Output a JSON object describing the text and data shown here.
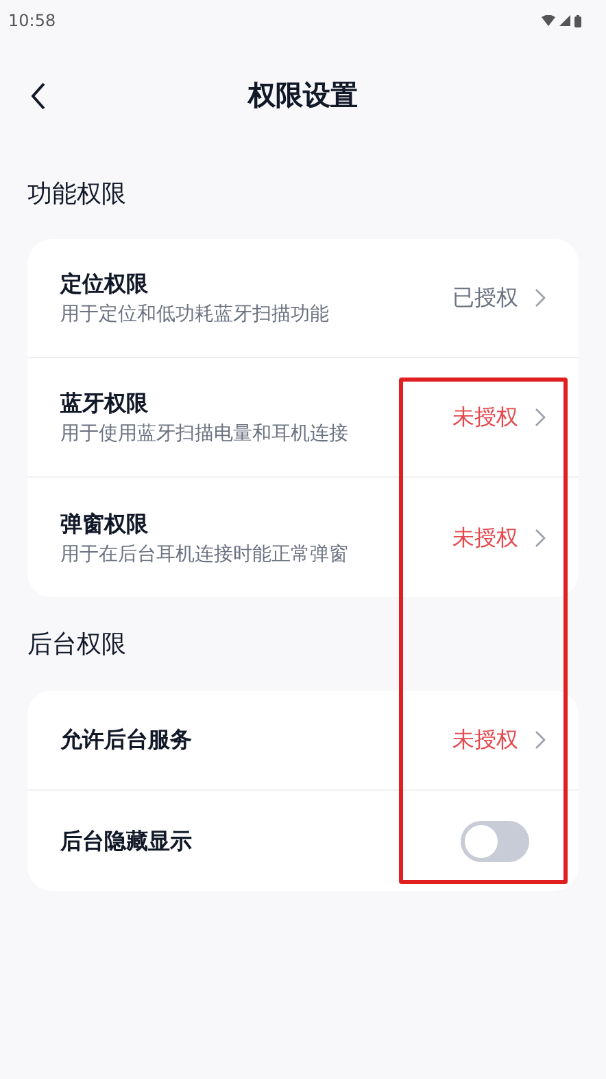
{
  "status_bar": {
    "time": "10:58"
  },
  "header": {
    "title": "权限设置"
  },
  "sections": [
    {
      "title": "功能权限",
      "items": [
        {
          "kind": "link",
          "label": "定位权限",
          "description": "用于定位和低功耗蓝牙扫描功能",
          "status": "已授权",
          "granted": true
        },
        {
          "kind": "link",
          "label": "蓝牙权限",
          "description": "用于使用蓝牙扫描电量和耳机连接",
          "status": "未授权",
          "granted": false
        },
        {
          "kind": "link",
          "label": "弹窗权限",
          "description": "用于在后台耳机连接时能正常弹窗",
          "status": "未授权",
          "granted": false
        }
      ]
    },
    {
      "title": "后台权限",
      "items": [
        {
          "kind": "link",
          "label": "允许后台服务",
          "status": "未授权",
          "granted": false
        },
        {
          "kind": "toggle",
          "label": "后台隐藏显示",
          "on": false
        }
      ]
    }
  ]
}
